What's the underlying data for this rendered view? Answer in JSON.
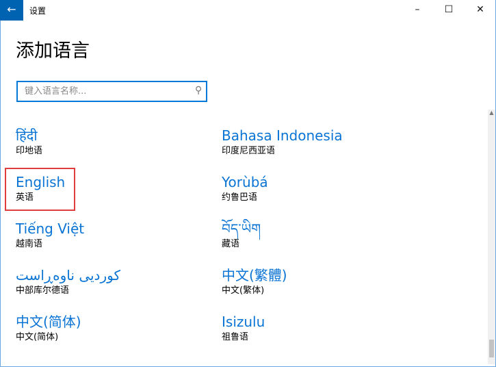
{
  "window": {
    "title": "设置",
    "back_icon": "arrow-left-icon",
    "minimize": "–",
    "maximize": "☐",
    "close": "✕",
    "accent": "#0063b1"
  },
  "page": {
    "heading": "添加语言"
  },
  "search": {
    "placeholder": "键入语言名称...",
    "value": "",
    "icon": "search-icon"
  },
  "languages": [
    {
      "name": "हिंदी",
      "sub": "印地语"
    },
    {
      "name": "Bahasa Indonesia",
      "sub": "印度尼西亚语"
    },
    {
      "name": "English",
      "sub": "英语",
      "highlighted": true
    },
    {
      "name": "Yorùbá",
      "sub": "约鲁巴语"
    },
    {
      "name": "Tiếng Việt",
      "sub": "越南语"
    },
    {
      "name": "བོད་ཡིག",
      "sub": "藏语"
    },
    {
      "name": "کوردیی ناوەڕاست",
      "sub": "中部库尔德语"
    },
    {
      "name": "中文(繁體)",
      "sub": "中文(繁体)"
    },
    {
      "name": "中文(简体)",
      "sub": "中文(简体)"
    },
    {
      "name": "Isizulu",
      "sub": "祖鲁语"
    }
  ],
  "colors": {
    "link": "#0a74d4",
    "highlight_box": "#e03c3c",
    "focus": "#0078d7"
  }
}
